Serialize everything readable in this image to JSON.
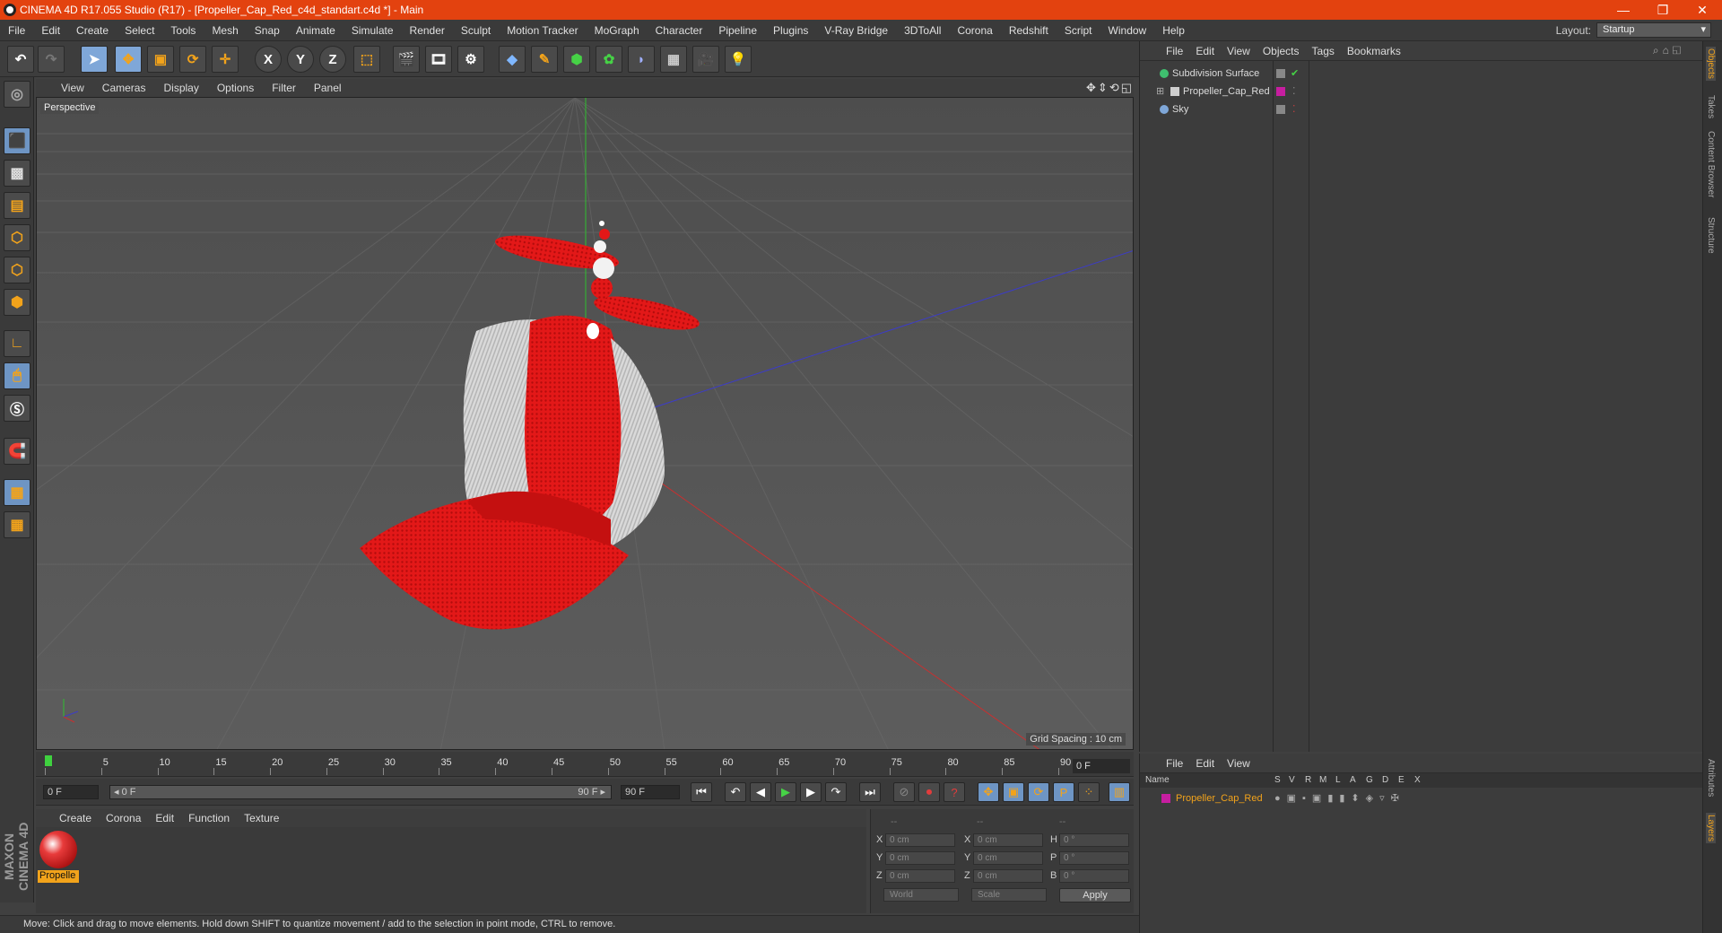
{
  "window": {
    "title": "CINEMA 4D R17.055 Studio (R17) - [Propeller_Cap_Red_c4d_standart.c4d *] - Main",
    "minimize": "—",
    "restore": "❐",
    "close": "✕"
  },
  "menu": [
    "File",
    "Edit",
    "Create",
    "Select",
    "Tools",
    "Mesh",
    "Snap",
    "Animate",
    "Simulate",
    "Render",
    "Sculpt",
    "Motion Tracker",
    "MoGraph",
    "Character",
    "Pipeline",
    "Plugins",
    "V-Ray Bridge",
    "3DToAll",
    "Corona",
    "Redshift",
    "Script",
    "Window",
    "Help"
  ],
  "layout": {
    "label": "Layout:",
    "value": "Startup"
  },
  "toolbar": {
    "x": "X",
    "y": "Y",
    "z": "Z"
  },
  "viewport": {
    "menu": [
      "View",
      "Cameras",
      "Display",
      "Options",
      "Filter",
      "Panel"
    ],
    "label": "Perspective",
    "grid_spacing": "Grid Spacing : 10 cm",
    "nav": "✥⇕⟲◱"
  },
  "timeline": {
    "ticks": [
      "0",
      "5",
      "10",
      "15",
      "20",
      "25",
      "30",
      "35",
      "40",
      "45",
      "50",
      "55",
      "60",
      "65",
      "70",
      "75",
      "80",
      "85",
      "90"
    ],
    "current": "0 F"
  },
  "playbar": {
    "start": "0 F",
    "range_start": "◂ 0 F",
    "range_end": "90 F ▸",
    "end": "90 F"
  },
  "materials": {
    "menu": [
      "Create",
      "Corona",
      "Edit",
      "Function",
      "Texture"
    ],
    "item": "Propelle"
  },
  "coords": {
    "headers": [
      "--",
      "--",
      "--"
    ],
    "rows": [
      {
        "a": "X",
        "av": "0 cm",
        "b": "X",
        "bv": "0 cm",
        "c": "H",
        "cv": "0 °"
      },
      {
        "a": "Y",
        "av": "0 cm",
        "b": "Y",
        "bv": "0 cm",
        "c": "P",
        "cv": "0 °"
      },
      {
        "a": "Z",
        "av": "0 cm",
        "b": "Z",
        "bv": "0 cm",
        "c": "B",
        "cv": "0 °"
      }
    ],
    "mode": "World",
    "type": "Scale",
    "apply": "Apply"
  },
  "status": "Move: Click and drag to move elements. Hold down SHIFT to quantize movement / add to the selection in point mode, CTRL to remove.",
  "objects": {
    "menu": [
      "File",
      "Edit",
      "View",
      "Objects",
      "Tags",
      "Bookmarks"
    ],
    "items": [
      {
        "name": "Subdivision Surface",
        "color": "#3fbf6f"
      },
      {
        "name": "Propeller_Cap_Red",
        "color": "#cfcfcf"
      },
      {
        "name": "Sky",
        "color": "#7fa7d8"
      }
    ]
  },
  "layers": {
    "menu": [
      "File",
      "Edit",
      "View"
    ],
    "columns": [
      "Name",
      "S",
      "V",
      "R",
      "M",
      "L",
      "A",
      "G",
      "D",
      "E",
      "X"
    ],
    "item": "Propeller_Cap_Red"
  },
  "right_tabs": [
    "Objects",
    "Takes",
    "Content Browser",
    "Structure",
    "Attributes",
    "Layers"
  ],
  "colors": {
    "accent": "#e3420f",
    "highlight": "#f2a31b",
    "selected": "#6e95c4"
  }
}
